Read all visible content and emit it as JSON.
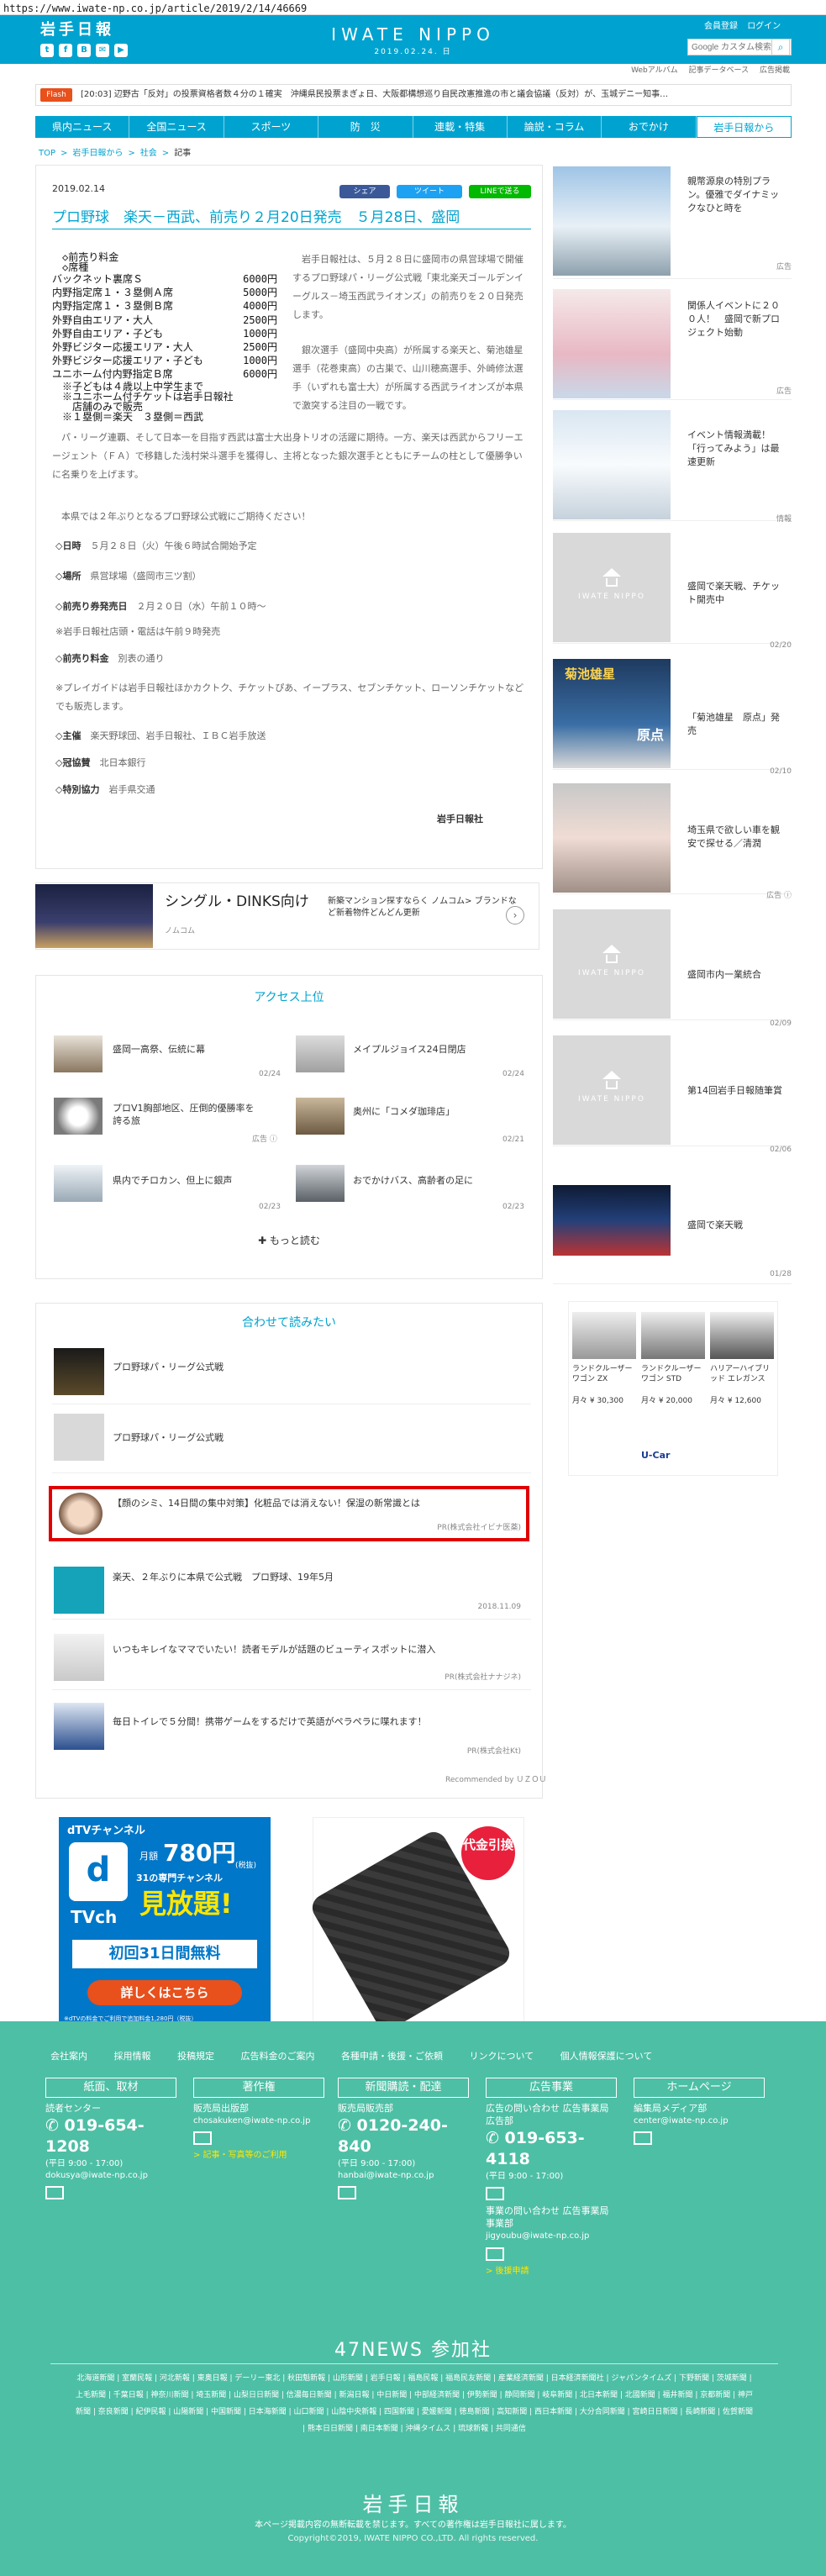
{
  "browser": {
    "url": "https://www.iwate-np.co.jp/article/2019/2/14/46669"
  },
  "header": {
    "logo_small": "岩手日報",
    "logo_main": "IWATE NIPPO",
    "date": "2019.02.24. 日",
    "login_links": [
      "会員登録",
      "ログイン"
    ],
    "search_placeholder": "Google カスタム検索",
    "social": [
      "t",
      "f",
      "B",
      "✉",
      "▶"
    ]
  },
  "subnav": [
    "Webアルバム",
    "記事データベース",
    "広告掲載"
  ],
  "ticker": {
    "label": "Flash",
    "text": "[20:03] 辺野古「反対」の投票資格者数４分の１確実　沖縄県民投票まぎょ日、大阪都構想巡り自民改憲推進の市と議会協議（反対）が、玉城デニー知事…"
  },
  "nav": [
    "県内ニュース",
    "全国ニュース",
    "スポーツ",
    "防　災",
    "連載・特集",
    "論説・コラム",
    "おでかけ",
    "岩手日報から"
  ],
  "breadcrumb": [
    "TOP",
    ">",
    "岩手日報から",
    ">",
    "社会",
    ">",
    "記事"
  ],
  "article": {
    "date": "2019.02.14",
    "share": [
      "シェア",
      "ツイート",
      "LINEで送る"
    ],
    "title": "プロ野球　楽天－西武、前売り２月20日発売　５月28日、盛岡",
    "price_head": [
      "◇前売り料金",
      "◇席種"
    ],
    "prices": [
      {
        "seat": "バックネット裏席Ｓ",
        "price": "6000円"
      },
      {
        "seat": "内野指定席１・３塁側Ａ席",
        "price": "5000円"
      },
      {
        "seat": "内野指定席１・３塁側Ｂ席",
        "price": "4000円"
      },
      {
        "seat": "外野自由エリア・大人",
        "price": "2500円"
      },
      {
        "seat": "外野自由エリア・子ども",
        "price": "1000円"
      },
      {
        "seat": "外野ビジター応援エリア・大人",
        "price": "2500円"
      },
      {
        "seat": "外野ビジター応援エリア・子ども",
        "price": "1000円"
      },
      {
        "seat": "ユニホーム付内野指定Ｂ席",
        "price": "6000円"
      }
    ],
    "price_notes": [
      "※子どもは４歳以上中学生まで",
      "※ユニホーム付チケットは岩手日報社",
      "　店舗のみで販売",
      "※１塁側＝楽天　３塁側＝西武"
    ],
    "para1": "　岩手日報社は、５月２８日に盛岡市の県営球場で開催するプロ野球パ・リーグ公式戦「東北楽天ゴールデンイーグルス－埼玉西武ライオンズ」の前売りを２０日発売します。",
    "para2": "　銀次選手（盛岡中央高）が所属する楽天と、菊池雄星選手（花巻東高）の古巣で、山川穂高選手、外崎修汰選手（いずれも富士大）が所属する西武ライオンズが本県で激突する注目の一戦です。",
    "para3": "　パ・リーグ連覇、そして日本一を目指す西武は富士大出身トリオの活躍に期待。一方、楽天は西武からフリーエージェント（ＦＡ）で移籍した浅村栄斗選手を獲得し、主将となった銀次選手とともにチームの柱として優勝争いに名乗りを上げます。",
    "para4": "　本県では２年ぶりとなるプロ野球公式戦にご期待ください！",
    "info": [
      {
        "label": "◇日時",
        "value": "５月２８日（火）午後６時試合開始予定"
      },
      {
        "label": "◇場所",
        "value": "県営球場（盛岡市三ツ割）"
      },
      {
        "label": "◇前売り券発売日",
        "value": "２月２０日（水）午前１０時～"
      },
      {
        "label": "",
        "value": "※岩手日報社店頭・電話は午前９時発売"
      },
      {
        "label": "◇前売り料金",
        "value": "別表の通り"
      },
      {
        "label": "",
        "value": "※プレイガイドは岩手日報社ほかカクトク、チケットぴあ、イープラス、セブンチケット、ローソンチケットなどでも販売します。"
      },
      {
        "label": "◇主催",
        "value": "楽天野球団、岩手日報社、ＩＢＣ岩手放送"
      },
      {
        "label": "◇冠協賛",
        "value": "北日本銀行"
      },
      {
        "label": "◇特別協力",
        "value": "岩手県交通"
      }
    ],
    "byline": "岩手日報社"
  },
  "ad1": {
    "title": "シングル・DINKS向け",
    "sub": "ノムコム",
    "text": "新築マンション探すならく ノムコム> ブランドなど新着物件どんどん更新",
    "arrow": "›"
  },
  "access": {
    "title": "アクセス上位",
    "items": [
      {
        "text": "盛岡一高祭、伝統に幕",
        "date": "02/24"
      },
      {
        "text": "メイプルジョイス24日閉店",
        "date": "02/24"
      },
      {
        "text": "プロV1胸部地区、圧倒的優勝率を誇る旅",
        "date": "広告 ⓘ"
      },
      {
        "text": "奥州に「コメダ珈琲店」",
        "date": "02/21"
      },
      {
        "text": "県内でチロカン、但上に銀声",
        "date": "02/23"
      },
      {
        "text": "おでかけバス、高齢者の足に",
        "date": "02/23"
      }
    ],
    "more": "✚ もっと読む"
  },
  "related": {
    "title": "合わせて読みたい",
    "items": [
      {
        "text": "プロ野球パ・リーグ公式戦",
        "sub": ""
      },
      {
        "text": "プロ野球パ・リーグ公式戦",
        "sub": ""
      },
      {
        "text": "【顔のシミ、14日間の集中対策】化粧品では消えない！保湿の新常識とは",
        "sub": "PR(株式会社イビナ医薬)"
      },
      {
        "text": "楽天、２年ぶりに本県で公式戦　プロ野球、19年5月",
        "sub": "2018.11.09"
      },
      {
        "text": "いつもキレイなママでいたい！読者モデルが話題のビューティスポットに潜入",
        "sub": "PR(株式会社ナナジネ)"
      },
      {
        "text": "毎日トイレで５分間！携帯ゲームをするだけで英語がペラペラに喋れます！",
        "sub": "PR(株式会社Kt)"
      }
    ],
    "recommended": "Recommended by ＵＺＯＵ"
  },
  "dtv_ad": {
    "channel": "dTVチャンネル",
    "price_prefix": "月額",
    "price": "780円",
    "tax": "(税抜)",
    "lineup": "31の専門チャンネル",
    "headline": "見放題!",
    "free": "初回31日間無料",
    "button": "詳しくはこちら",
    "note": "※dTVの料金でご利用で追加料金1,280円（税抜）"
  },
  "wallet_ad": {
    "badge": "代金引換"
  },
  "sidebar": {
    "items": [
      {
        "title": "親幣源泉の特別プラン。優雅でダイナミックなひと時を",
        "date": "広告",
        "img": "ski"
      },
      {
        "title": "関係人イベントに２００人！　盛岡で新プロジェクト始動",
        "date": "広告",
        "img": "event"
      },
      {
        "title": "イベント情報満載！「行ってみよう」は最速更新",
        "date": "情報",
        "img": "snow"
      },
      {
        "title": "盛岡で楽天戦、チケット開売中",
        "date": "02/20",
        "img": "placeholder"
      },
      {
        "title": "「菊池雄星　原点」発売",
        "date": "02/10",
        "img": "book"
      },
      {
        "title": "埼玉県で欲しい車を観安で探せる／清潤",
        "date": "広告 ⓘ",
        "img": "car"
      },
      {
        "title": "盛岡市内一業統合",
        "date": "02/09",
        "img": "placeholder"
      },
      {
        "title": "第14回岩手日報随筆賞",
        "date": "02/06",
        "img": "placeholder"
      },
      {
        "title": "盛岡で楽天戦",
        "date": "01/28",
        "img": "stadium"
      }
    ],
    "placeholder_logo": "IWATE NIPPO",
    "side_ad": {
      "cars": [
        {
          "name": "ランドクルーザーワゴン ZX",
          "price": "月々 ¥ 30,300"
        },
        {
          "name": "ランドクルーザー ワゴン STD",
          "price": "月々 ¥ 20,000"
        },
        {
          "name": "ハリアーハイブリッド エレガンス",
          "price": "月々 ¥ 12,600"
        }
      ],
      "brand": "U-Car"
    },
    "book_title": "菊池雄星",
    "book_sub": "原点"
  },
  "footer": {
    "links": [
      "会社案内",
      "採用情報",
      "投稿規定",
      "広告料金のご案内",
      "各種申請・後援・ご依頼",
      "リンクについて",
      "個人情報保護について"
    ],
    "cols": [
      {
        "head": "紙面、取材",
        "label": "読者センター",
        "phone": "019-654-1208",
        "hours": "(平日 9:00 - 17:00)",
        "mail": "dokusya@iwate-np.co.jp",
        "link": ""
      },
      {
        "head": "著作権",
        "label": "販売局出版部",
        "phone": "",
        "hours": "",
        "mail": "chosakuken@iwate-np.co.jp",
        "link": "> 記事・写真等のご利用"
      },
      {
        "head": "新聞購読・配達",
        "label": "販売局販売部",
        "phone": "0120-240-840",
        "hours": "(平日 9:00 - 17:00)",
        "mail": "hanbai@iwate-np.co.jp",
        "link": ""
      },
      {
        "head": "広告事業",
        "label": "広告の問い合わせ 広告事業局広告部",
        "phone": "019-653-4118",
        "hours": "(平日 9:00 - 17:00)",
        "mail": "",
        "link": ""
      },
      {
        "head": "ホームページ",
        "label": "編集局メディア部",
        "phone": "",
        "hours": "",
        "mail": "center@iwate-np.co.jp",
        "link": ""
      }
    ],
    "jigyo": {
      "label": "事業の問い合わせ 広告事業局事業部",
      "mail": "jigyoubu@iwate-np.co.jp",
      "link": "> 後援申請"
    },
    "heading_47": "47NEWS 参加社",
    "papers": "北海道新聞 | 室蘭民報 | 河北新報 | 東奥日報 | デーリー東北 | 秋田魁新報 | 山形新聞 | 岩手日報 | 福島民報 | 福島民友新聞 | 産業経済新聞 | 日本経済新聞社 | ジャパンタイムズ | 下野新聞 | 茨城新聞 | 上毛新聞 | 千葉日報 | 神奈川新聞 | 埼玉新聞 | 山梨日日新聞 | 信濃毎日新聞 | 新潟日報 | 中日新聞 | 中部経済新聞 | 伊勢新聞 | 静岡新聞 | 岐阜新聞 | 北日本新聞 | 北國新聞 | 福井新聞 | 京都新聞 | 神戸新聞 | 奈良新聞 | 紀伊民報 | 山陽新聞 | 中国新聞 | 日本海新聞 | 山口新聞 | 山陰中央新報 | 四国新聞 | 愛媛新聞 | 徳島新聞 | 高知新聞 | 西日本新聞 | 大分合同新聞 | 宮崎日日新聞 | 長崎新聞 | 佐賀新聞 | 熊本日日新聞 | 南日本新聞 | 沖縄タイムス | 琉球新報 | 共同通信",
    "logo": "岩手日報",
    "note": "本ページ掲載内容の無断転載を禁じます。すべての著作権は岩手日報社に属します。",
    "copyright": "Copyright©2019, IWATE NIPPO CO.,LTD. All rights reserved."
  },
  "colors": {
    "brand": "#00a3cf",
    "footer": "#4dbfa5",
    "flash": "#e8501c",
    "highlight": "#e00000"
  }
}
